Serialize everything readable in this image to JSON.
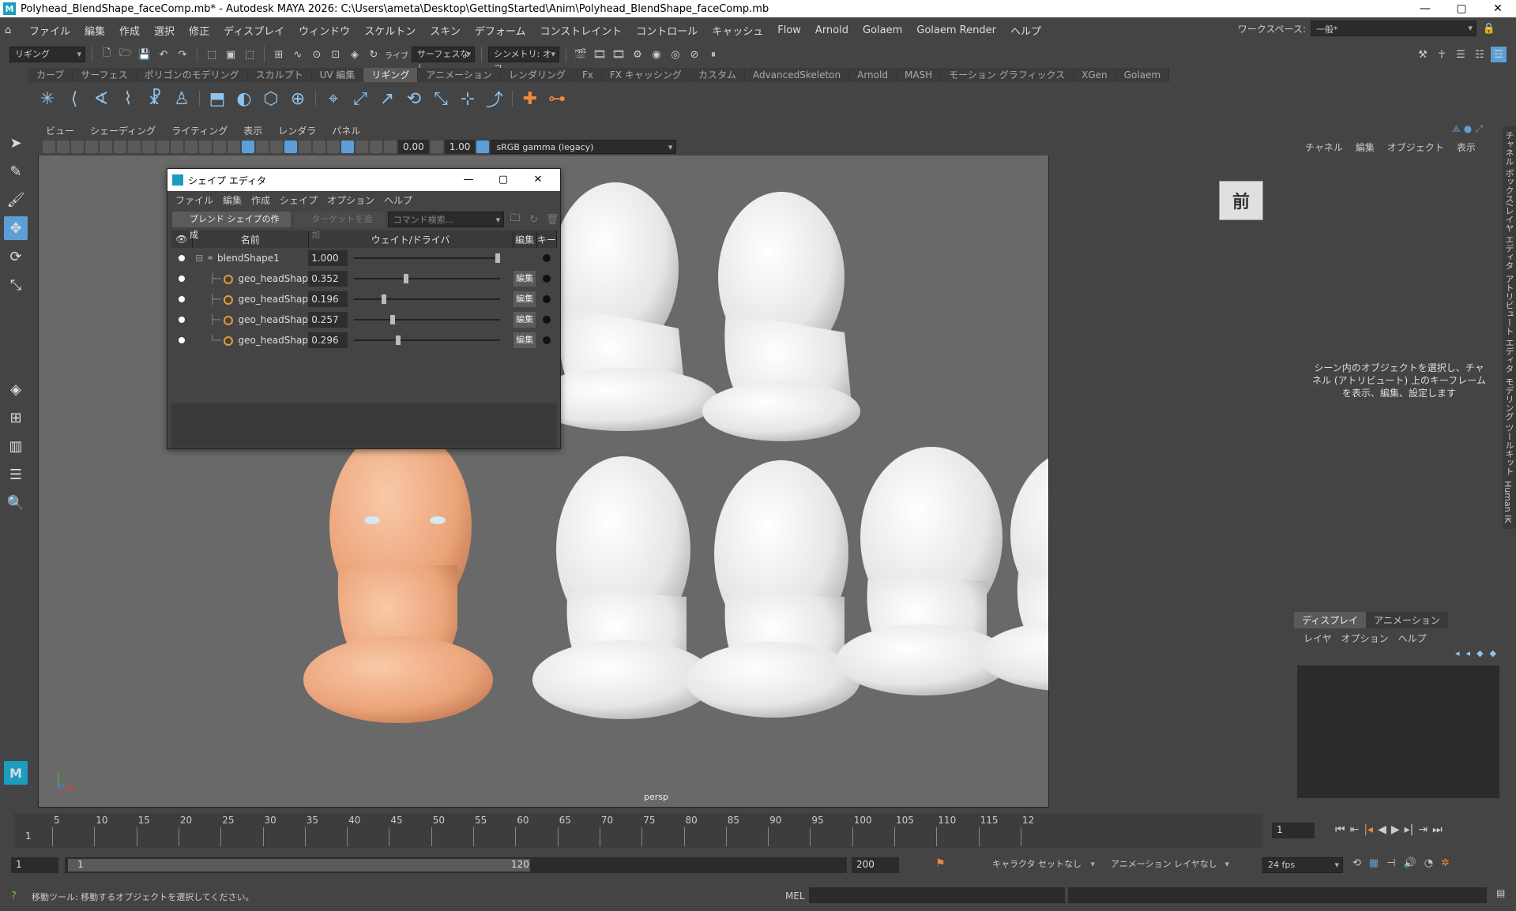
{
  "titlebar": {
    "title": "Polyhead_BlendShape_faceComp.mb* - Autodesk MAYA 2026: C:\\Users\\ameta\\Desktop\\GettingStarted\\Anim\\Polyhead_BlendShape_faceComp.mb",
    "minimize": "—",
    "maximize": "▢",
    "close": "✕"
  },
  "menubar": {
    "items": [
      "ファイル",
      "編集",
      "作成",
      "選択",
      "修正",
      "ディスプレイ",
      "ウィンドウ",
      "スケルトン",
      "スキン",
      "デフォーム",
      "コンストレイント",
      "コントロール",
      "キャッシュ",
      "Flow",
      "Arnold",
      "Golaem",
      "Golaem Render",
      "ヘルプ"
    ],
    "workspace_label": "ワークスペース:",
    "workspace_value": "一般*"
  },
  "statusline": {
    "menuset": "リギング",
    "live_label": "ライブ",
    "live_value": "サーフェスなし",
    "symmetry": "シンメトリ: オフ"
  },
  "shelf": {
    "tabs": [
      "カーブ",
      "サーフェス",
      "ポリゴンのモデリング",
      "スカルプト",
      "UV 編集",
      "リギング",
      "アニメーション",
      "レンダリング",
      "Fx",
      "FX キャッシング",
      "カスタム",
      "AdvancedSkeleton",
      "Arnold",
      "MASH",
      "モーション グラフィックス",
      "XGen",
      "Golaem"
    ],
    "active_tab": "リギング"
  },
  "viewport": {
    "menu": [
      "ビュー",
      "シェーディング",
      "ライティング",
      "表示",
      "レンダラ",
      "パネル"
    ],
    "exposure": "0.00",
    "gamma": "1.00",
    "colorspace": "sRGB gamma (legacy)",
    "camera_label": "persp",
    "viewcube_face": "前"
  },
  "shape_editor": {
    "title": "シェイプ エディタ",
    "menu": [
      "ファイル",
      "編集",
      "作成",
      "シェイプ",
      "オプション",
      "ヘルプ"
    ],
    "create_blend": "ブレンド シェイプの作成",
    "add_target": "ターゲットを追加",
    "search_placeholder": "コマンド検索...",
    "columns": {
      "name": "名前",
      "weight": "ウェイト/ドライバ",
      "edit": "編集",
      "key": "キー"
    },
    "rows": [
      {
        "name": "blendShape1",
        "weight": "1.000",
        "fraction": 1.0,
        "edit": ""
      },
      {
        "name": "geo_headShap",
        "weight": "0.352",
        "fraction": 0.352,
        "edit": "編集"
      },
      {
        "name": "geo_headShap",
        "weight": "0.196",
        "fraction": 0.196,
        "edit": "編集"
      },
      {
        "name": "geo_headShap",
        "weight": "0.257",
        "fraction": 0.257,
        "edit": "編集"
      },
      {
        "name": "geo_headShap",
        "weight": "0.296",
        "fraction": 0.296,
        "edit": "編集"
      }
    ]
  },
  "channel_box": {
    "menu": [
      "チャネル",
      "編集",
      "オブジェクト",
      "表示"
    ],
    "message": "シーン内のオブジェクトを選択し、チャネル (アトリビュート) 上のキーフレームを表示、編集、設定します",
    "side_tabs": [
      "チャネル ボックス/レイヤ エディタ",
      "アトリビュート エディタ",
      "モデリング ツールキット",
      "Human IK"
    ]
  },
  "layer_editor": {
    "tabs": [
      "ディスプレイ",
      "アニメーション"
    ],
    "menu": [
      "レイヤ",
      "オプション",
      "ヘルプ"
    ]
  },
  "timeslider": {
    "ticks": [
      "5",
      "10",
      "15",
      "20",
      "25",
      "30",
      "35",
      "40",
      "45",
      "50",
      "55",
      "60",
      "65",
      "70",
      "75",
      "80",
      "85",
      "90",
      "95",
      "100",
      "105",
      "110",
      "115",
      "12"
    ],
    "first": "1",
    "current_frame": "1"
  },
  "range": {
    "start": "1",
    "inner_start": "1",
    "inner_end": "120",
    "end": "200",
    "character": "キャラクタ セットなし",
    "anim_layer": "アニメーション レイヤなし",
    "fps": "24 fps"
  },
  "helpline": {
    "text": "移動ツール: 移動するオブジェクトを選択してください。",
    "mel": "MEL"
  }
}
